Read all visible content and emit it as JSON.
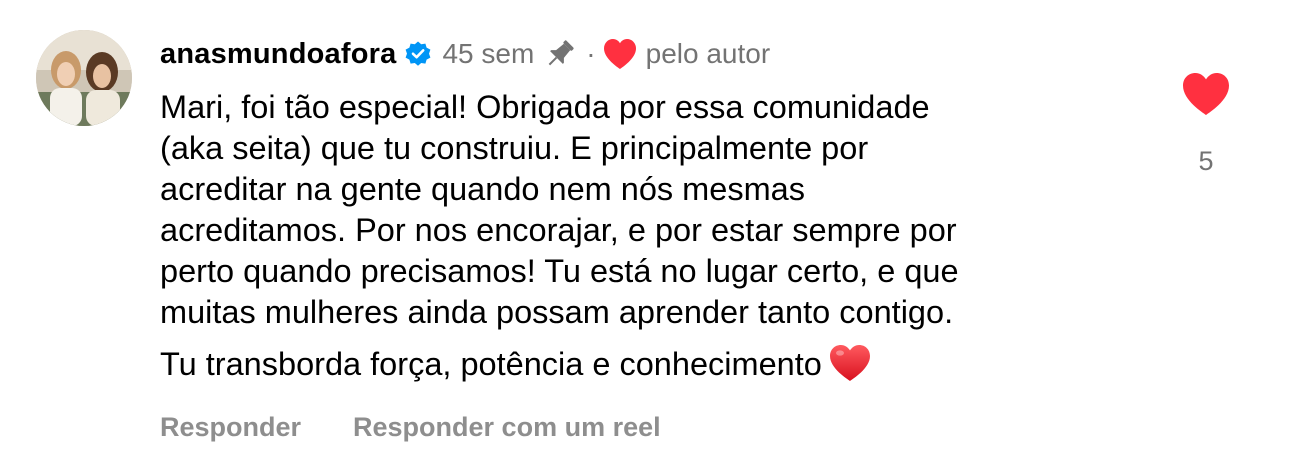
{
  "comment": {
    "username": "anasmundoafora",
    "time_ago": "45 sem",
    "separator": "·",
    "liked_by_author_label": "pelo autor",
    "paragraphs": [
      "Mari, foi tão especial! Obrigada por essa comunidade\n(aka seita) que tu construiu. E principalmente por\nacreditar na gente quando nem nós mesmas\nacreditamos. Por nos encorajar, e por estar sempre por\nperto quando precisamos! Tu está no lugar certo, e que\nmuitas mulheres ainda possam aprender tanto contigo.",
      "Tu transborda força, potência e conhecimento"
    ],
    "like_count": "5",
    "is_liked": true,
    "is_pinned": true,
    "is_verified": true
  },
  "actions": {
    "reply_label": "Responder",
    "reply_with_reel_label": "Responder com um reel"
  },
  "icons": {
    "verified": "verified-badge-icon",
    "pin": "pin-icon",
    "author_like": "heart-icon",
    "emoji": "red-heart-emoji",
    "like": "heart-icon"
  },
  "colors": {
    "like_red": "#ff3040",
    "verified_blue": "#0095f6",
    "secondary_text": "#737373",
    "action_text": "#8e8e8e"
  }
}
